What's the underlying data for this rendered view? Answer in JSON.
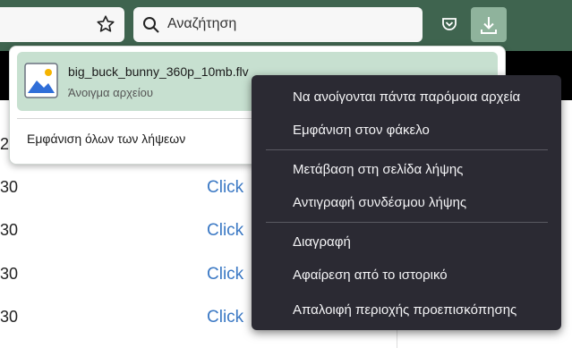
{
  "toolbar": {
    "search_placeholder": "Αναζήτηση",
    "accent_color": "#3f644f",
    "icons": [
      "star-icon",
      "search-icon",
      "pocket-icon",
      "download-icon"
    ]
  },
  "page": {
    "rows": [
      {
        "num": "2",
        "link": ""
      },
      {
        "num": "30",
        "link": "Click"
      },
      {
        "num": "30",
        "link": "Click"
      },
      {
        "num": "30",
        "link": "Click"
      },
      {
        "num": "30",
        "link": "Click"
      }
    ]
  },
  "downloads": {
    "item": {
      "filename": "big_buck_bunny_360p_10mb.flv",
      "status": "Άνοιγμα αρχείου"
    },
    "show_all": "Εμφάνιση όλων των λήψεων"
  },
  "context_menu": {
    "items": [
      "Να ανοίγονται πάντα παρόμοια αρχεία",
      "Εμφάνιση στον φάκελο",
      "Μετάβαση στη σελίδα λήψης",
      "Αντιγραφή συνδέσμου λήψης",
      "Διαγραφή",
      "Αφαίρεση από το ιστορικό",
      "Απαλοιφή περιοχής προεπισκόπησης"
    ]
  }
}
